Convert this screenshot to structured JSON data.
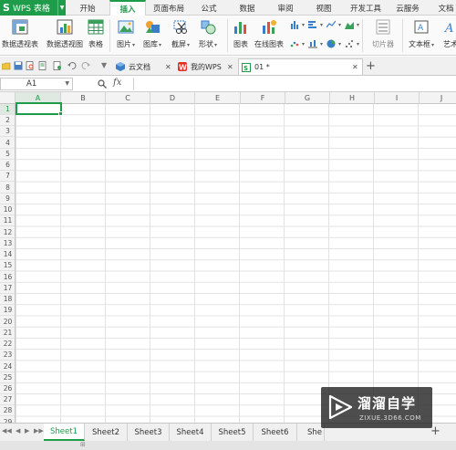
{
  "app": {
    "name": "WPS 表格",
    "logo": "S"
  },
  "menu_tabs": [
    {
      "label": "开始"
    },
    {
      "label": "插入"
    },
    {
      "label": "页面布局"
    },
    {
      "label": "公式"
    },
    {
      "label": "数据"
    },
    {
      "label": "审阅"
    },
    {
      "label": "视图"
    },
    {
      "label": "开发工具"
    },
    {
      "label": "云服务"
    },
    {
      "label": "文档"
    }
  ],
  "active_menu_tab": "插入",
  "ribbon": {
    "pivot_table": "数据透视表",
    "pivot_chart": "数据透视图",
    "table": "表格",
    "picture": "图片",
    "gallery": "图库",
    "screenshot": "截屏",
    "shapes": "形状",
    "chart": "图表",
    "online_chart": "在线图表",
    "slicer": "切片器",
    "textbox": "文本框",
    "art": "艺术"
  },
  "doc_tabs": [
    {
      "label": "云文档"
    },
    {
      "label": "我的WPS"
    },
    {
      "label": "01 *"
    }
  ],
  "formula_bar": {
    "cell_ref": "A1",
    "fx": "fx"
  },
  "columns": [
    "A",
    "B",
    "C",
    "D",
    "E",
    "F",
    "G",
    "H",
    "I",
    "J"
  ],
  "rows": [
    "1",
    "2",
    "3",
    "4",
    "5",
    "6",
    "7",
    "8",
    "9",
    "10",
    "11",
    "12",
    "13",
    "14",
    "15",
    "16",
    "17",
    "18",
    "19",
    "20",
    "21",
    "22",
    "23",
    "24",
    "25",
    "26",
    "27",
    "28",
    "29"
  ],
  "sheets": [
    "Sheet1",
    "Sheet2",
    "Sheet3",
    "Sheet4",
    "Sheet5",
    "Sheet6",
    "She"
  ],
  "active_sheet": "Sheet1",
  "watermark": {
    "title": "溜溜自学",
    "url": "ZIXUE.3D66.COM"
  },
  "colors": {
    "accent": "#1f9c4a",
    "grid": "#e2e2e2"
  }
}
